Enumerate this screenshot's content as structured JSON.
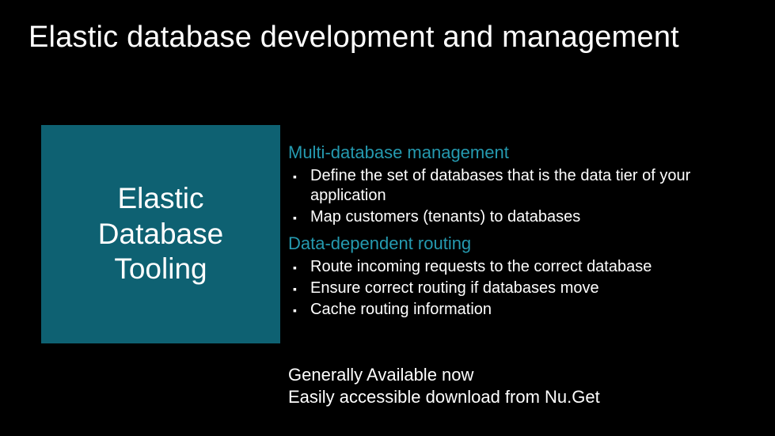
{
  "title": "Elastic database development and management",
  "box_label": "Elastic\nDatabase\nTooling",
  "sections": [
    {
      "heading": "Multi-database management",
      "bullets": [
        "Define the set of databases that is the data tier of your application",
        "Map customers (tenants) to databases"
      ]
    },
    {
      "heading": "Data-dependent routing",
      "bullets": [
        "Route incoming requests to the correct database",
        "Ensure correct routing if databases move",
        "Cache routing information"
      ]
    }
  ],
  "footer": {
    "line1": "Generally Available now",
    "line2": "Easily accessible download from Nu.Get"
  }
}
